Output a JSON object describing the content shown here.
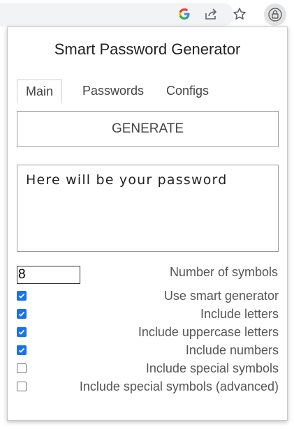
{
  "toolbar": {
    "icons": [
      "google-g-icon",
      "share-icon",
      "star-icon",
      "extension-icon"
    ]
  },
  "popup": {
    "title": "Smart Password Generator",
    "tabs": [
      {
        "label": "Main",
        "active": true
      },
      {
        "label": "Passwords",
        "active": false
      },
      {
        "label": "Configs",
        "active": false
      }
    ],
    "generate_label": "GENERATE",
    "password_output": "Here will be your password",
    "symbols_count": "8",
    "symbols_label": "Number of symbols",
    "options": [
      {
        "label": "Use smart generator",
        "checked": true
      },
      {
        "label": "Include letters",
        "checked": true
      },
      {
        "label": "Include uppercase letters",
        "checked": true
      },
      {
        "label": "Include numbers",
        "checked": true
      },
      {
        "label": "Include special symbols",
        "checked": false
      },
      {
        "label": "Include special symbols (advanced)",
        "checked": false
      }
    ]
  },
  "colors": {
    "checkbox_accent": "#1a73e8",
    "border": "#9a9a9a",
    "text": "#555555"
  }
}
